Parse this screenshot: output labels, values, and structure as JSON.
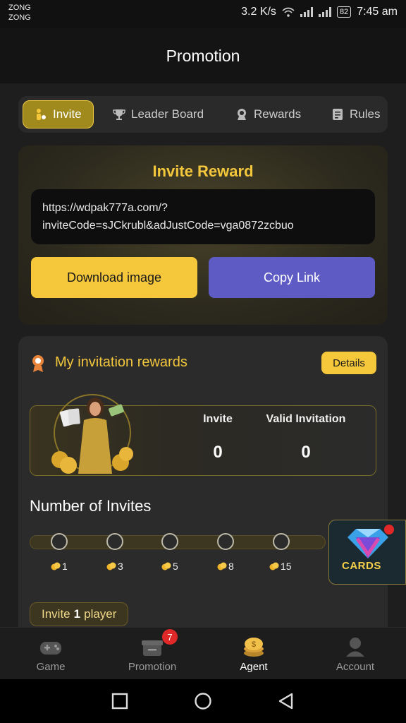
{
  "status": {
    "carrier1": "ZONG",
    "carrier2": "ZONG",
    "speed": "3.2 K/s",
    "battery": "82",
    "time": "7:45 am"
  },
  "header": {
    "title": "Promotion"
  },
  "tabs": [
    {
      "label": "Invite",
      "icon": "invite-icon",
      "active": true
    },
    {
      "label": "Leader Board",
      "icon": "trophy-icon"
    },
    {
      "label": "Rewards",
      "icon": "reward-medal-icon"
    },
    {
      "label": "Rules",
      "icon": "rules-document-icon"
    }
  ],
  "invite": {
    "title": "Invite Reward",
    "link_line1": "https://wdpak777a.com/?",
    "link_line2": "inviteCode=sJCkrubl&adJustCode=vga0872zcbuo",
    "download_label": "Download image",
    "copy_label": "Copy Link"
  },
  "rewards": {
    "title": "My invitation rewards",
    "details_label": "Details",
    "invite_label": "Invite",
    "invite_value": "0",
    "valid_label": "Valid Invitation",
    "valid_value": "0",
    "number_heading": "Number of Invites",
    "milestones": [
      "1",
      "3",
      "5",
      "8",
      "15"
    ],
    "invite_player_prefix": "Invite",
    "invite_player_count": "1",
    "invite_player_suffix": "player"
  },
  "floating": {
    "label": "CARDS"
  },
  "nav": [
    {
      "label": "Game",
      "icon": "gamepad-icon"
    },
    {
      "label": "Promotion",
      "icon": "gift-box-icon",
      "badge": "7"
    },
    {
      "label": "Agent",
      "icon": "coin-stack-icon",
      "active": true
    },
    {
      "label": "Account",
      "icon": "user-icon"
    }
  ],
  "colors": {
    "accent": "#f5c73a",
    "copy_button": "#5e5cc4",
    "badge": "#e02828"
  }
}
